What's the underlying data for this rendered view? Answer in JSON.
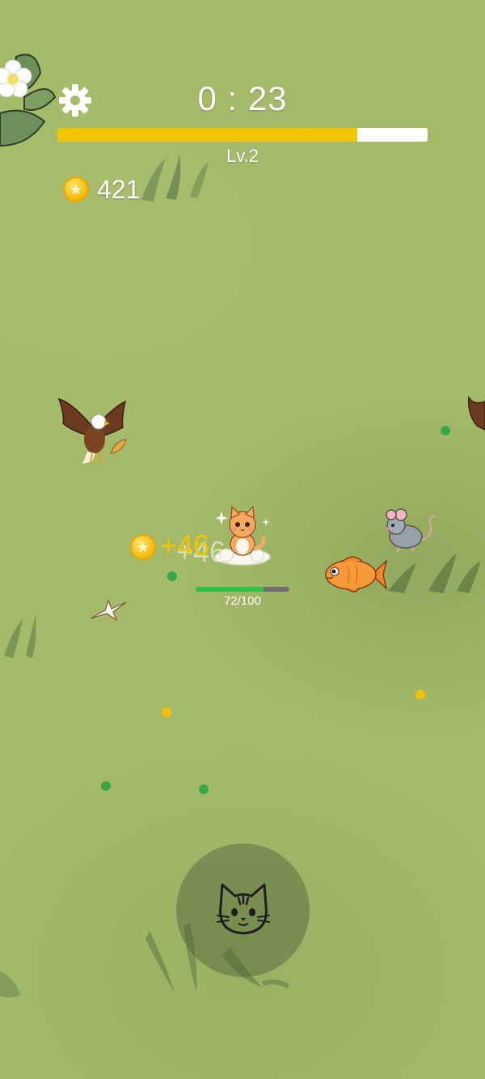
{
  "hud": {
    "timer": "0 : 23",
    "level": "Lv.2",
    "xp_progress": 0.81,
    "coins": "421"
  },
  "player": {
    "hp_text": "72/100",
    "hp_fraction": 0.72,
    "pickup_text": "+46"
  },
  "icons": {
    "settings": "gear-icon",
    "coin": "coin-icon",
    "joystick": "cat-face-icon"
  },
  "colors": {
    "background": "#a5b96a",
    "xp_fill": "#f2c500",
    "hp_fill": "#2ec24a",
    "coin": "#f0b400",
    "orb_green": "#3aa64a",
    "orb_yellow": "#f2c20a"
  }
}
